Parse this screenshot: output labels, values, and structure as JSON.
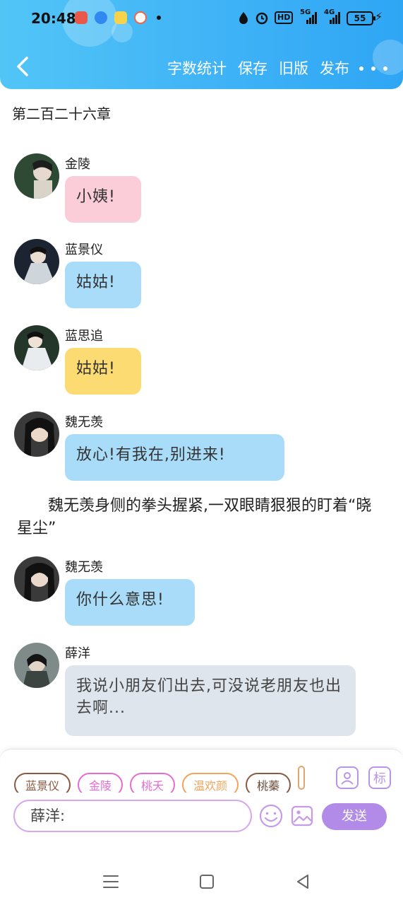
{
  "status_bar": {
    "time": "20:48",
    "network_label": "HD",
    "signal_5g": "5G",
    "signal_4g": "4G",
    "battery": "55"
  },
  "header": {
    "actions": [
      "字数统计",
      "保存",
      "旧版",
      "发布"
    ],
    "back_icon": "chevron-left-icon",
    "more_icon": "more-dots-icon"
  },
  "chapter_title": "第二百二十六章",
  "messages": [
    {
      "name": "金陵",
      "text": "小姨!",
      "color": "#fbcdd8"
    },
    {
      "name": "蓝景仪",
      "text": "姑姑!",
      "color": "#a9dcf9"
    },
    {
      "name": "蓝思追",
      "text": "姑姑!",
      "color": "#fcdc72"
    },
    {
      "name": "魏无羡",
      "text": "放心!有我在,别进来!",
      "color": "#a9dcf9"
    },
    {
      "name": "魏无羡",
      "text": "你什么意思!",
      "color": "#a9dcf9"
    },
    {
      "name": "薛洋",
      "text": "我说小朋友们出去,可没说老朋友也出去啊...",
      "color": "#dee5ed"
    }
  ],
  "narration": "魏无羡身侧的拳头握紧,一双眼睛狠狠的盯着“晓星尘”",
  "composer": {
    "chips": [
      "蓝景仪",
      "金陵",
      "桃夭",
      "温欢颜",
      "桃蓁",
      ""
    ],
    "input_value": "薛洋:",
    "mark_label": "标",
    "send_label": "发送"
  }
}
